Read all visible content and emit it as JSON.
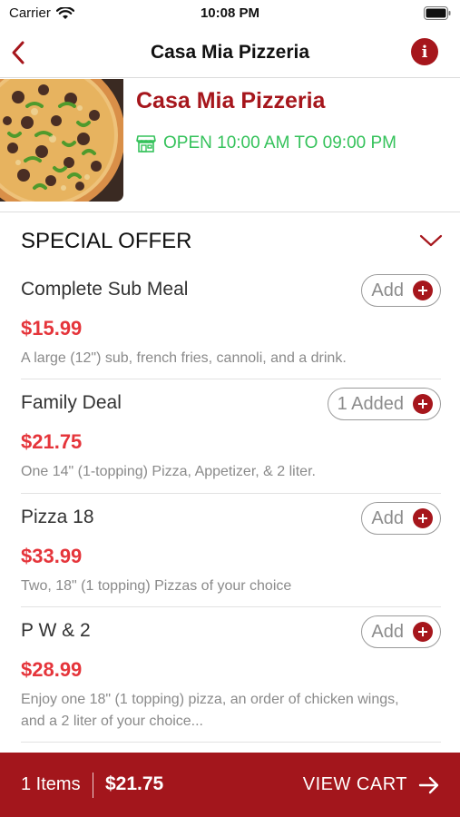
{
  "status_bar": {
    "carrier": "Carrier",
    "time": "10:08 PM",
    "icons": [
      "wifi-icon",
      "battery-icon"
    ]
  },
  "nav": {
    "title": "Casa Mia Pizzeria",
    "back_icon": "chevron-left-icon",
    "info_icon": "info-icon",
    "info_glyph": "i"
  },
  "restaurant": {
    "name": "Casa Mia Pizzeria",
    "hours": "OPEN 10:00 AM TO 09:00 PM",
    "hours_icon": "store-icon",
    "image": "pizza-photo"
  },
  "section": {
    "title": "SPECIAL OFFER",
    "toggle_icon": "chevron-down-icon",
    "items": [
      {
        "name": "Complete Sub Meal",
        "price": "$15.99",
        "description": "A large (12\") sub, french fries, cannoli, and a drink.",
        "button_label": "Add"
      },
      {
        "name": "Family Deal",
        "price": "$21.75",
        "description": "One 14\" (1-topping) Pizza, Appetizer, & 2 liter.",
        "button_label": "1 Added"
      },
      {
        "name": "Pizza 18",
        "price": "$33.99",
        "description": "Two, 18\" (1 topping) Pizzas of your choice",
        "button_label": "Add"
      },
      {
        "name": "P W & 2",
        "price": "$28.99",
        "description": "Enjoy one 18\" (1 topping) pizza, an order of chicken wings, and a 2 liter of your choice...",
        "button_label": "Add"
      }
    ]
  },
  "cart": {
    "count_label": "1 Items",
    "total": "$21.75",
    "view_label": "VIEW CART",
    "arrow_icon": "arrow-right-icon"
  },
  "colors": {
    "brand_red": "#a6161c",
    "price_red": "#e5353b",
    "open_green": "#35c25b"
  }
}
